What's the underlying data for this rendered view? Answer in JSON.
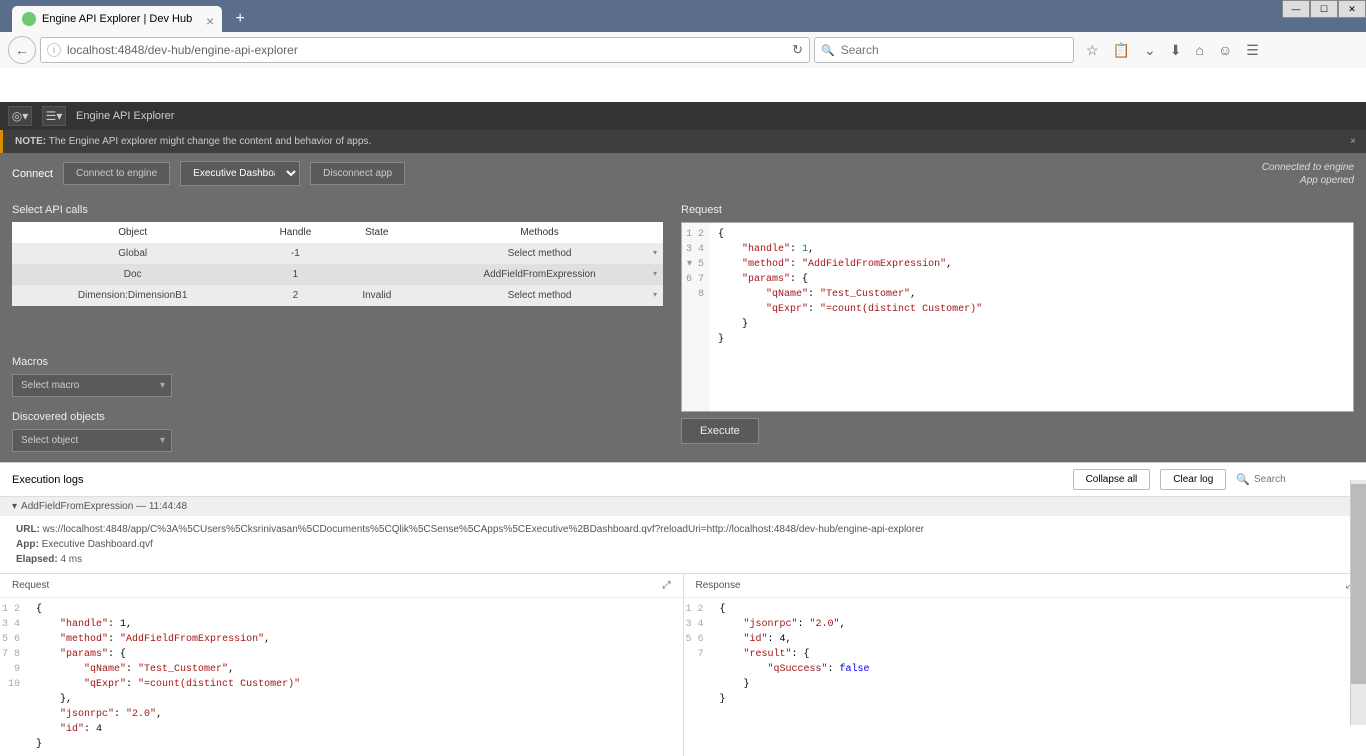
{
  "browser": {
    "tab_title": "Engine API Explorer | Dev Hub",
    "url": "localhost:4848/dev-hub/engine-api-explorer",
    "search_placeholder": "Search"
  },
  "header": {
    "title": "Engine API Explorer"
  },
  "warning": {
    "prefix": "NOTE:",
    "text": "The Engine API explorer might change the content and behavior of apps."
  },
  "connect": {
    "label": "Connect",
    "connect_btn": "Connect to engine",
    "app_select": "Executive Dashboard",
    "disconnect_btn": "Disconnect app",
    "status1": "Connected to engine",
    "status2": "App opened"
  },
  "api_calls": {
    "label": "Select API calls",
    "cols": {
      "object": "Object",
      "handle": "Handle",
      "state": "State",
      "methods": "Methods"
    },
    "rows": [
      {
        "object": "Global",
        "handle": "-1",
        "state": "",
        "method": "Select method"
      },
      {
        "object": "Doc",
        "handle": "1",
        "state": "",
        "method": "AddFieldFromExpression"
      },
      {
        "object": "Dimension:DimensionB1",
        "handle": "2",
        "state": "Invalid",
        "method": "Select method"
      }
    ]
  },
  "macros": {
    "label": "Macros",
    "placeholder": "Select macro"
  },
  "discovered": {
    "label": "Discovered objects",
    "placeholder": "Select object"
  },
  "request": {
    "label": "Request",
    "lines": [
      "1",
      "2",
      "3",
      "4",
      "5",
      "6",
      "7",
      "8"
    ]
  },
  "execute": "Execute",
  "logs": {
    "label": "Execution logs",
    "collapse": "Collapse all",
    "clear": "Clear log",
    "search_placeholder": "Search",
    "entry_title": "AddFieldFromExpression — 11:44:48",
    "url_label": "URL:",
    "url": "ws://localhost:4848/app/C%3A%5CUsers%5Cksrinivasan%5CDocuments%5CQlik%5CSense%5CApps%5CExecutive%2BDashboard.qvf?reloadUri=http://localhost:4848/dev-hub/engine-api-explorer",
    "app_label": "App:",
    "app": "Executive Dashboard.qvf",
    "elapsed_label": "Elapsed:",
    "elapsed": "4 ms",
    "req_label": "Request",
    "resp_label": "Response",
    "req_lines": [
      "1",
      "2",
      "3",
      "4",
      "5",
      "6",
      "7",
      "8",
      "9",
      "10"
    ],
    "resp_lines": [
      "1",
      "2",
      "3",
      "4",
      "5",
      "6",
      "7"
    ]
  }
}
